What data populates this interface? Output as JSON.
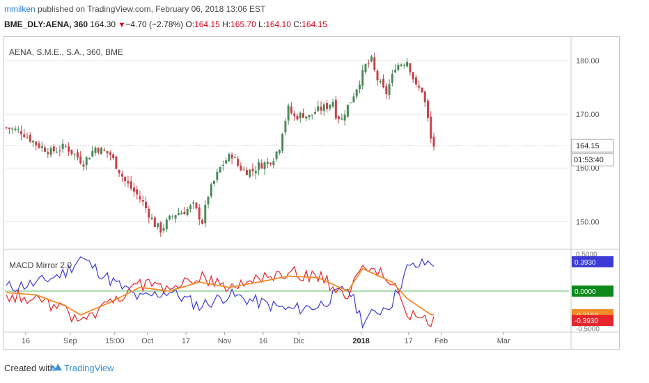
{
  "header": {
    "user": "mmilken",
    "published_text": "published on TradingView.com, February 06, 2018 13:06 EST",
    "symbol": "BME_DLY:AENA, 360",
    "last": "164.30",
    "change_arrow": "▼",
    "change": "−4.70 (−2.78%)",
    "open_label": "O:",
    "open": "164.15",
    "high_label": "H:",
    "high": "165.70",
    "low_label": "L:",
    "low": "164.10",
    "close_label": "C:",
    "close": "164.15"
  },
  "footer": {
    "created_with": "Created with",
    "brand": "TradingView"
  },
  "colors": {
    "up_candle": "#4c8a5a",
    "down_candle": "#c4424a",
    "macd_blue": "#3b3bd6",
    "macd_red": "#e6242b",
    "signal_orange": "#f28c28",
    "zero_line": "#5cb85c",
    "grid": "#e8e8e8"
  },
  "chart_data": [
    {
      "type": "candlestick",
      "title": "AENA, S.M.E., S.A., 360, BME",
      "y_ticks": [
        "150.00",
        "160.00",
        "170.00",
        "180.00"
      ],
      "ylim": [
        145,
        184
      ],
      "last_price_label": "164.15",
      "countdown_label": "01:53:40",
      "x_ticks": [
        "16",
        "Sep",
        "15:00",
        "Oct",
        "17",
        "Nov",
        "16",
        "Dic",
        "2018",
        "17",
        "Feb",
        "Mar"
      ],
      "close_path": [
        [
          0,
          167.5
        ],
        [
          5,
          166.8
        ],
        [
          10,
          164.5
        ],
        [
          15,
          163.0
        ],
        [
          20,
          164.0
        ],
        [
          26,
          161.0
        ],
        [
          30,
          163.8
        ],
        [
          35,
          162.5
        ],
        [
          38,
          159.5
        ],
        [
          40,
          157.5
        ],
        [
          44,
          155.0
        ],
        [
          46,
          153.5
        ],
        [
          48,
          151.5
        ],
        [
          50,
          149.5
        ],
        [
          52,
          148.5
        ],
        [
          55,
          150.5
        ],
        [
          57,
          151.5
        ],
        [
          60,
          152.0
        ],
        [
          63,
          153.0
        ],
        [
          66,
          150.0
        ],
        [
          68,
          155.0
        ],
        [
          70,
          157.5
        ],
        [
          72,
          160.0
        ],
        [
          74,
          161.5
        ],
        [
          76,
          162.5
        ],
        [
          78,
          160.5
        ],
        [
          80,
          159.5
        ],
        [
          83,
          159.5
        ],
        [
          85,
          160.5
        ],
        [
          88,
          161.0
        ],
        [
          90,
          162.0
        ],
        [
          92,
          164.0
        ],
        [
          93,
          167.0
        ],
        [
          95,
          171.0
        ],
        [
          97,
          169.5
        ],
        [
          100,
          170.0
        ],
        [
          102,
          169.5
        ],
        [
          104,
          170.5
        ],
        [
          106,
          171.0
        ],
        [
          108,
          171.5
        ],
        [
          110,
          172.5
        ],
        [
          111,
          170.0
        ],
        [
          113,
          169.0
        ],
        [
          114,
          170.5
        ],
        [
          116,
          172.5
        ],
        [
          118,
          175.0
        ],
        [
          120,
          177.5
        ],
        [
          121,
          179.0
        ],
        [
          123,
          180.0
        ],
        [
          124,
          178.0
        ],
        [
          125,
          176.5
        ],
        [
          127,
          174.5
        ],
        [
          128,
          174.0
        ],
        [
          130,
          177.0
        ],
        [
          131,
          179.0
        ],
        [
          133,
          179.5
        ],
        [
          135,
          180.0
        ],
        [
          136,
          178.5
        ],
        [
          138,
          175.0
        ],
        [
          140,
          174.5
        ],
        [
          141,
          172.0
        ],
        [
          142,
          169.0
        ],
        [
          142.6,
          167.0
        ],
        [
          143.3,
          164.15
        ]
      ]
    },
    {
      "type": "line",
      "title": "MACD Mirror 2.0",
      "y_ticks": [
        "-0.5000",
        "0.5000"
      ],
      "ylim": [
        -0.55,
        0.55
      ],
      "labels": [
        {
          "text": "0.3930",
          "value": 0.393,
          "color": "#3b3bd6"
        },
        {
          "text": "0.0000",
          "value": 0.0,
          "color": "#0d8a1a"
        },
        {
          "text": "-0.3158",
          "value": -0.3158,
          "color": "#f28c28"
        },
        {
          "text": "-0.3930",
          "value": -0.393,
          "color": "#e6242b"
        }
      ],
      "series": [
        {
          "color": "#3b3bd6",
          "values_path": [
            [
              0,
              0.05
            ],
            [
              10,
              0.1
            ],
            [
              20,
              0.25
            ],
            [
              25,
              0.45
            ],
            [
              35,
              0.15
            ],
            [
              45,
              -0.1
            ],
            [
              55,
              0.0
            ],
            [
              65,
              -0.2
            ],
            [
              75,
              -0.05
            ],
            [
              85,
              -0.15
            ],
            [
              95,
              -0.25
            ],
            [
              105,
              -0.2
            ],
            [
              115,
              0.05
            ],
            [
              120,
              -0.4
            ],
            [
              130,
              -0.15
            ],
            [
              135,
              0.3
            ],
            [
              143,
              0.39
            ]
          ]
        },
        {
          "color": "#e6242b",
          "values_path": [
            [
              0,
              -0.05
            ],
            [
              10,
              -0.1
            ],
            [
              20,
              -0.25
            ],
            [
              25,
              -0.45
            ],
            [
              35,
              -0.15
            ],
            [
              45,
              0.1
            ],
            [
              55,
              0.0
            ],
            [
              65,
              0.2
            ],
            [
              75,
              0.05
            ],
            [
              85,
              0.15
            ],
            [
              95,
              0.25
            ],
            [
              105,
              0.2
            ],
            [
              115,
              -0.05
            ],
            [
              120,
              0.4
            ],
            [
              130,
              0.15
            ],
            [
              135,
              -0.3
            ],
            [
              143,
              -0.39
            ]
          ]
        },
        {
          "color": "#f28c28",
          "values_path": [
            [
              0,
              -0.02
            ],
            [
              10,
              -0.05
            ],
            [
              20,
              -0.2
            ],
            [
              25,
              -0.32
            ],
            [
              35,
              -0.15
            ],
            [
              45,
              0.05
            ],
            [
              55,
              0.0
            ],
            [
              65,
              0.12
            ],
            [
              75,
              0.05
            ],
            [
              85,
              0.12
            ],
            [
              95,
              0.2
            ],
            [
              105,
              0.18
            ],
            [
              115,
              0.0
            ],
            [
              120,
              0.3
            ],
            [
              130,
              0.12
            ],
            [
              135,
              -0.1
            ],
            [
              143,
              -0.3158
            ]
          ]
        }
      ]
    }
  ]
}
